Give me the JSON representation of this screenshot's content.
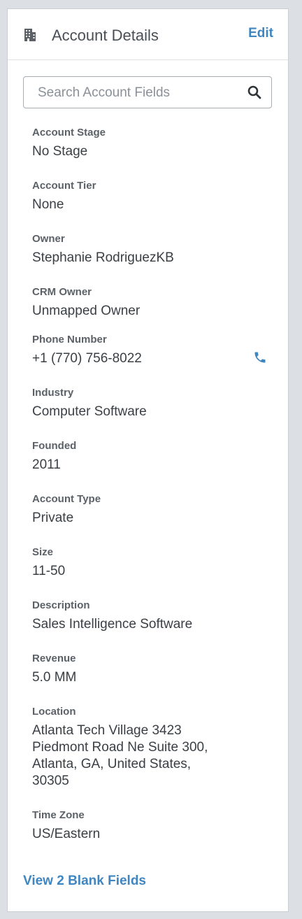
{
  "header": {
    "title": "Account Details",
    "edit_label": "Edit"
  },
  "search": {
    "placeholder": "Search Account Fields"
  },
  "fields": [
    {
      "label": "Account Stage",
      "value": "No Stage"
    },
    {
      "label": "Account Tier",
      "value": "None"
    },
    {
      "label": "Owner",
      "value": "Stephanie RodriguezKB"
    },
    {
      "label": "CRM Owner",
      "value": "Unmapped Owner"
    },
    {
      "label": "Phone Number",
      "value": "+1 (770) 756-8022"
    },
    {
      "label": "Industry",
      "value": "Computer Software"
    },
    {
      "label": "Founded",
      "value": "2011"
    },
    {
      "label": "Account Type",
      "value": "Private"
    },
    {
      "label": "Size",
      "value": "11-50"
    },
    {
      "label": "Description",
      "value": "Sales Intelligence Software"
    },
    {
      "label": "Revenue",
      "value": "5.0 MM"
    },
    {
      "label": "Location",
      "value": "Atlanta Tech Village 3423 Piedmont Road Ne Suite 300, Atlanta, GA, United States, 30305"
    },
    {
      "label": "Time Zone",
      "value": "US/Eastern"
    }
  ],
  "footer": {
    "blank_fields_link": "View 2 Blank Fields"
  },
  "colors": {
    "accent": "#3f86c0",
    "text": "#3a3f44",
    "label": "#5b6167"
  },
  "icons": {
    "header": "building-icon",
    "search": "search-icon",
    "phone": "phone-icon"
  }
}
